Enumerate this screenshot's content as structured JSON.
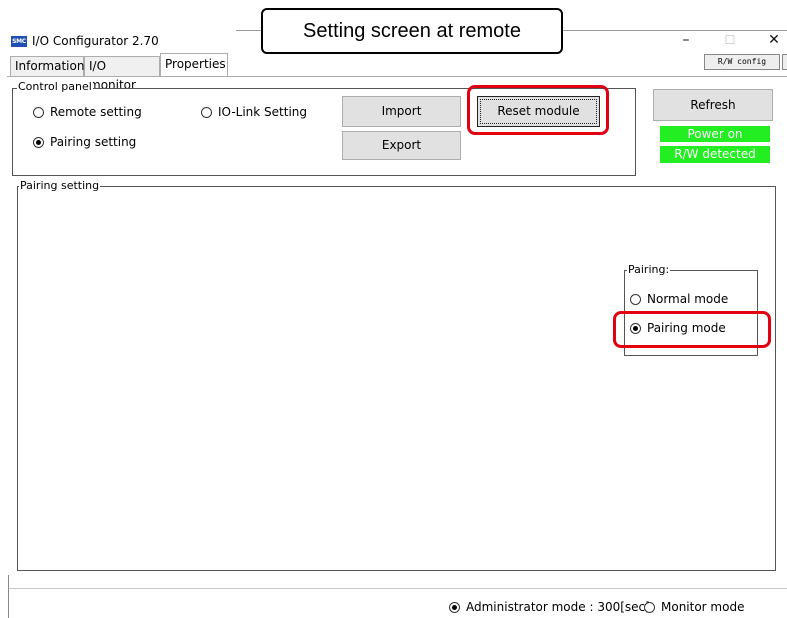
{
  "window": {
    "title": "I/O Configurator 2.70",
    "icon_text": "SMC",
    "minimize_glyph": "–",
    "maximize_glyph": "☐",
    "close_glyph": "✕"
  },
  "annotation": {
    "callout_text": "Setting screen at remote"
  },
  "tabs": [
    {
      "label": "Information"
    },
    {
      "label": "I/O monitor"
    },
    {
      "label": "Properties"
    }
  ],
  "rw_config_label": "R/W config",
  "control_panel": {
    "label": "Control panel",
    "options": [
      {
        "label": "Remote setting",
        "selected": false
      },
      {
        "label": "IO-Link Setting",
        "selected": false
      },
      {
        "label": "Pairing setting",
        "selected": true
      }
    ],
    "import_label": "Import",
    "export_label": "Export",
    "reset_module_label": "Reset module",
    "refresh_label": "Refresh",
    "status": [
      {
        "text": "Power on"
      },
      {
        "text": "R/W detected"
      }
    ],
    "status_color": "#22ee22"
  },
  "pairing_setting": {
    "label": "Pairing setting",
    "pairing_group": {
      "label": "Pairing:",
      "options": [
        {
          "label": "Normal mode",
          "selected": false
        },
        {
          "label": "Pairing mode",
          "selected": true
        }
      ]
    }
  },
  "footer": {
    "modes": [
      {
        "label": "Administrator mode : 300[sec]",
        "selected": true
      },
      {
        "label": "Monitor mode",
        "selected": false
      }
    ]
  },
  "highlight_color": "#e00012"
}
